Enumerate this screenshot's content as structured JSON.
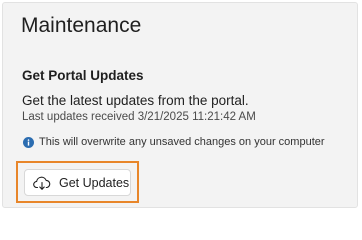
{
  "page": {
    "title": "Maintenance"
  },
  "portal_updates": {
    "section_title": "Get Portal Updates",
    "description": "Get the latest updates from the portal.",
    "last_updated": "Last updates received 3/21/2025 11:21:42 AM",
    "warning_icon": "info-icon",
    "warning_text": "This will overwrite any unsaved changes on your computer",
    "button_icon": "cloud-download-icon",
    "button_label": "Get Updates"
  },
  "colors": {
    "panel_background": "#f3f3f3",
    "highlight_border": "#e8862a",
    "info_icon": "#2b6cb0"
  }
}
